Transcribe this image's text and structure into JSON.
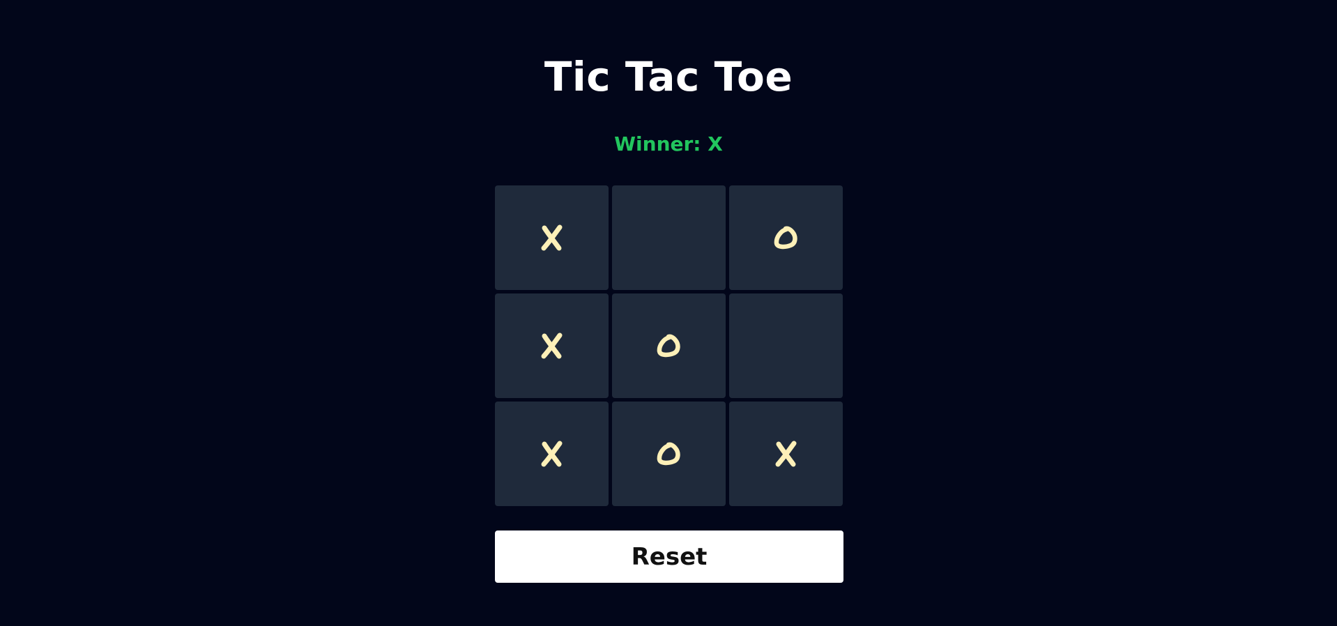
{
  "app": {
    "title": "Tic Tac Toe",
    "status": "Winner: X"
  },
  "board": {
    "cells": [
      "X",
      "",
      "O",
      "X",
      "O",
      "",
      "X",
      "O",
      "X"
    ]
  },
  "controls": {
    "reset_label": "Reset"
  },
  "colors": {
    "background": "#02061a",
    "cell": "#1f2a3b",
    "mark": "#fdf0b8",
    "status": "#22c55e",
    "title": "#ffffff"
  },
  "icons": {
    "x_mark": "hand-drawn-x-icon",
    "o_mark": "hand-drawn-o-icon"
  }
}
